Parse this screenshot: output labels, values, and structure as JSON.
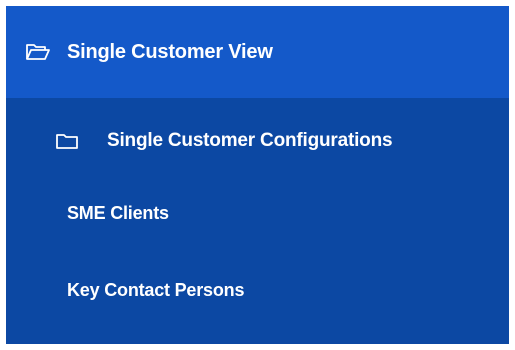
{
  "theme": {
    "header_bg": "#1459c9",
    "submenu_bg": "#0c48a3",
    "text_color": "#ffffff"
  },
  "menu": {
    "section": {
      "icon": "folder-open-icon",
      "label": "Single Customer View"
    },
    "group": {
      "icon": "folder-icon",
      "label": "Single Customer Configurations"
    },
    "items": [
      {
        "label": "SME Clients"
      },
      {
        "label": "Key Contact Persons"
      }
    ]
  }
}
